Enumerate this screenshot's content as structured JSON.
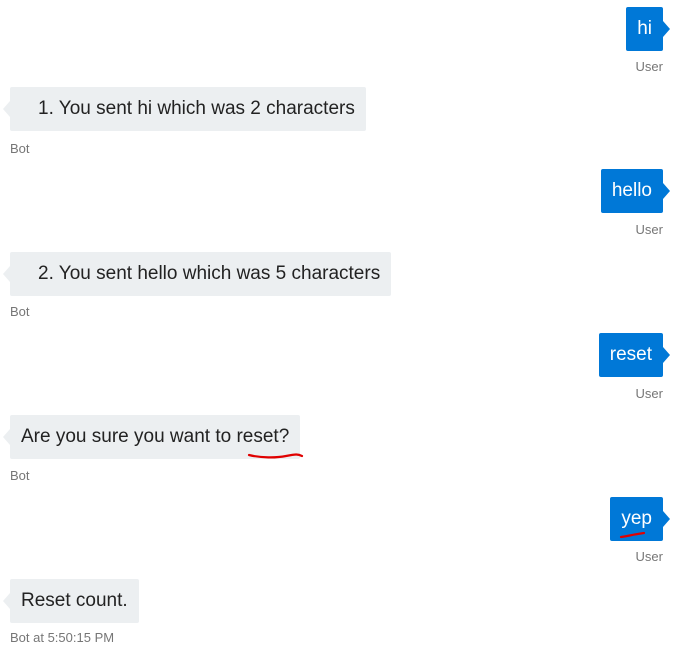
{
  "messages": [
    {
      "role": "user",
      "text": "hi",
      "sender": "User"
    },
    {
      "role": "bot",
      "text": "1. You sent hi which was 2 characters",
      "sender": "Bot"
    },
    {
      "role": "user",
      "text": "hello",
      "sender": "User"
    },
    {
      "role": "bot",
      "text": "2. You sent hello which was 5 characters",
      "sender": "Bot"
    },
    {
      "role": "user",
      "text": "reset",
      "sender": "User"
    },
    {
      "role": "bot",
      "text": "Are you sure you want to reset?",
      "sender": "Bot"
    },
    {
      "role": "user",
      "text": "yep",
      "sender": "User"
    },
    {
      "role": "bot",
      "text": "Reset count.",
      "sender": "Bot at 5:50:15 PM"
    }
  ],
  "colors": {
    "user_bubble": "#0078d7",
    "bot_bubble": "#eceff1",
    "annotation": "#e00000"
  }
}
